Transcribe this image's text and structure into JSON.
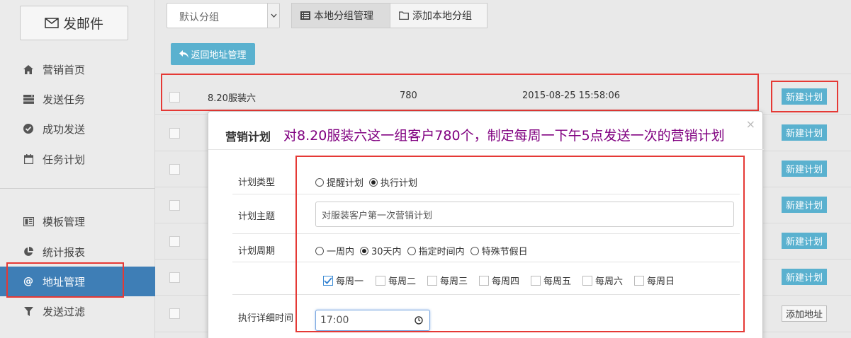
{
  "sidebar": {
    "compose_label": "发邮件",
    "items": [
      {
        "label": "营销首页",
        "icon": "home-icon"
      },
      {
        "label": "发送任务",
        "icon": "server-icon"
      },
      {
        "label": "成功发送",
        "icon": "check-circle-icon"
      },
      {
        "label": "任务计划",
        "icon": "calendar-icon"
      },
      {
        "label": "模板管理",
        "icon": "template-icon"
      },
      {
        "label": "统计报表",
        "icon": "pie-chart-icon"
      },
      {
        "label": "地址管理",
        "icon": "at-icon",
        "active": true
      },
      {
        "label": "发送过滤",
        "icon": "filter-icon"
      }
    ]
  },
  "toolbar": {
    "group_select_value": "默认分组",
    "local_manage_label": "本地分组管理",
    "add_local_label": "添加本地分组",
    "back_label": "返回地址管理"
  },
  "table": {
    "row1": {
      "name": "8.20服装六",
      "count": "780",
      "date": "2015-08-25 15:58:06"
    },
    "action_label": "新建计划",
    "add_address_label": "添加地址"
  },
  "modal": {
    "title": "营销计划",
    "note": "对8.20服装六这一组客户780个，制定每周一下午5点发送一次的营销计划",
    "close": "×",
    "plan_type_label": "计划类型",
    "plan_types": [
      "提醒计划",
      "执行计划"
    ],
    "subject_label": "计划主题",
    "subject_value": "对服装客户第一次营销计划",
    "period_label": "计划周期",
    "periods": [
      "一周内",
      "30天内",
      "指定时间内",
      "特殊节假日"
    ],
    "weekdays": [
      "每周一",
      "每周二",
      "每周三",
      "每周四",
      "每周五",
      "每周六",
      "每周日"
    ],
    "time_label": "执行详细时间",
    "time_value": "17:00"
  },
  "colors": {
    "accent": "#5ab1cf",
    "active_nav": "#3e7eb6",
    "highlight": "#e53935",
    "note": "#800080"
  }
}
